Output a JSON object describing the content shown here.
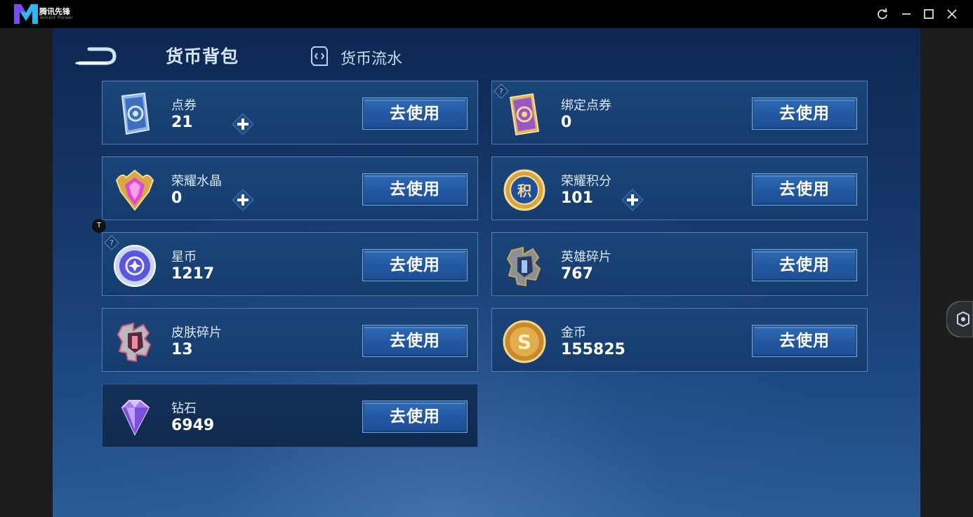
{
  "app": {
    "name": "腾讯先锋",
    "subname": "Tencent Pioneer"
  },
  "window_controls": [
    "refresh-icon",
    "minimize-icon",
    "maximize-icon",
    "close-icon"
  ],
  "header": {
    "title": "货币背包",
    "flow_tab": "货币流水"
  },
  "use_label": "去使用",
  "overlay_marker": "T",
  "currencies": [
    {
      "name": "点券",
      "value": "21",
      "icon": "coupon-card-icon",
      "plus": true,
      "help": false
    },
    {
      "name": "绑定点券",
      "value": "0",
      "icon": "bound-coupon-card-icon",
      "plus": false,
      "help": true
    },
    {
      "name": "荣耀水晶",
      "value": "0",
      "icon": "glory-crystal-icon",
      "plus": true,
      "help": false
    },
    {
      "name": "荣耀积分",
      "value": "101",
      "icon": "glory-points-icon",
      "plus": true,
      "help": false
    },
    {
      "name": "星币",
      "value": "1217",
      "icon": "star-coin-icon",
      "plus": false,
      "help": true
    },
    {
      "name": "英雄碎片",
      "value": "767",
      "icon": "hero-fragment-icon",
      "plus": false,
      "help": false
    },
    {
      "name": "皮肤碎片",
      "value": "13",
      "icon": "skin-fragment-icon",
      "plus": false,
      "help": false
    },
    {
      "name": "金币",
      "value": "155825",
      "icon": "gold-coin-icon",
      "plus": false,
      "help": false
    },
    {
      "name": "钻石",
      "value": "6949",
      "icon": "diamond-icon",
      "plus": false,
      "help": false
    }
  ],
  "colors": {
    "card_border": "#4a80c0",
    "button_fill": "#2257a0",
    "background_top": "#0e2752",
    "background_bottom": "#2a5c98"
  }
}
